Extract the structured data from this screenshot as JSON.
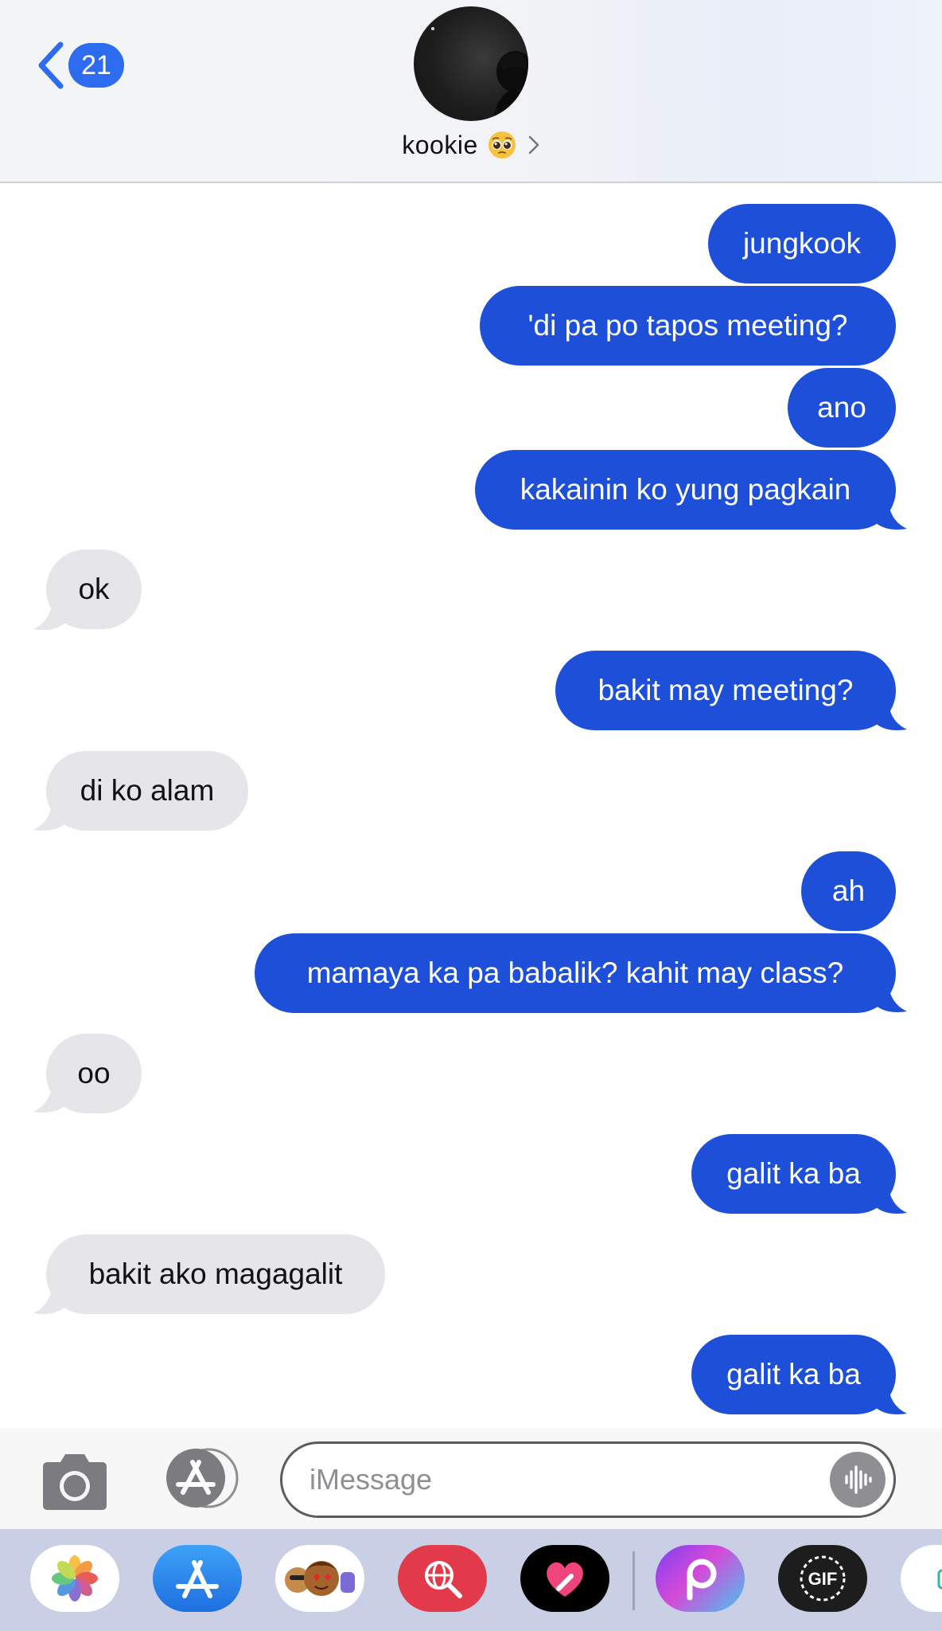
{
  "header": {
    "back_badge": "21",
    "contact_name": "kookie",
    "contact_emoji": "pleading-face-emoji"
  },
  "messages": [
    {
      "from": "me",
      "text": "jungkook"
    },
    {
      "from": "me",
      "text": "'di pa po tapos meeting?"
    },
    {
      "from": "me",
      "text": "ano"
    },
    {
      "from": "me",
      "text": "kakainin ko yung pagkain"
    },
    {
      "from": "them",
      "text": "ok"
    },
    {
      "from": "me",
      "text": "bakit may meeting?"
    },
    {
      "from": "them",
      "text": "di ko alam"
    },
    {
      "from": "me",
      "text": "ah"
    },
    {
      "from": "me",
      "text": "mamaya ka pa babalik? kahit may class?"
    },
    {
      "from": "them",
      "text": "oo"
    },
    {
      "from": "me",
      "text": "galit ka ba"
    },
    {
      "from": "them",
      "text": "bakit ako magagalit"
    },
    {
      "from": "me",
      "text": "galit ka ba"
    }
  ],
  "input": {
    "placeholder": "iMessage"
  },
  "app_drawer": [
    {
      "name": "photos-icon"
    },
    {
      "name": "app-store-icon"
    },
    {
      "name": "memoji-icon"
    },
    {
      "name": "search-images-icon"
    },
    {
      "name": "digital-touch-icon"
    },
    {
      "name": "picsart-icon"
    },
    {
      "name": "gif-icon"
    }
  ],
  "colors": {
    "sent_bubble": "#1e4fd8",
    "received_bubble": "#e5e5ea",
    "badge": "#2d6bf0"
  }
}
